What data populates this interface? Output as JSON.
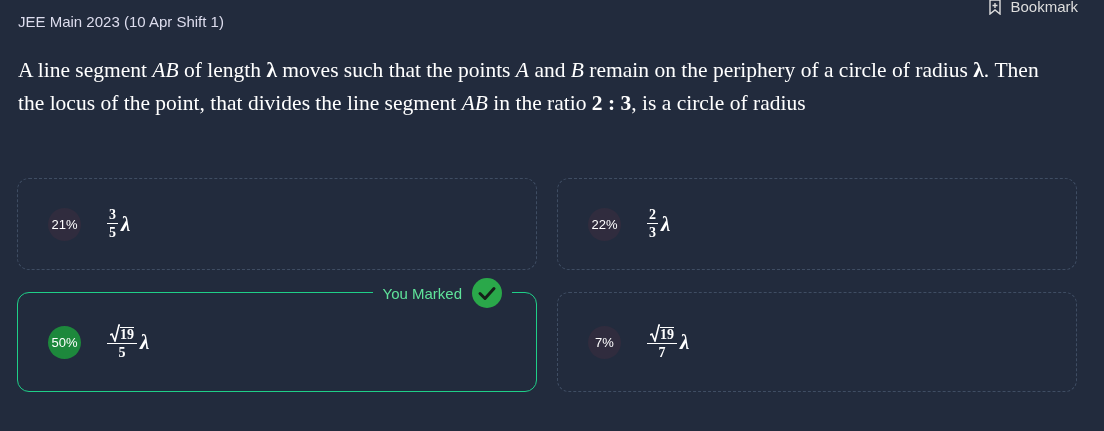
{
  "header": {
    "exam": "JEE Main 2023 (10 Apr Shift 1)",
    "bookmark": "Bookmark"
  },
  "question": "A line segment *AB* of length **λ** moves such that the points *A* and *B* remain on the periphery of a circle of radius **λ**. Then the locus of the point, that divides the line segment *AB* in the ratio **2 : 3**, is a circle of radius",
  "marked_label": "You Marked",
  "options": [
    {
      "kind": "fraction",
      "percent": "21%",
      "numerator": "3",
      "denominator": "5",
      "variable": "λ",
      "selected": false
    },
    {
      "kind": "fraction",
      "percent": "22%",
      "numerator": "2",
      "denominator": "3",
      "variable": "λ",
      "selected": false
    },
    {
      "kind": "root_fraction",
      "percent": "50%",
      "numerator": "19",
      "denominator": "5",
      "variable": "λ",
      "selected": true
    },
    {
      "kind": "root_fraction",
      "percent": "7%",
      "numerator": "19",
      "denominator": "7",
      "variable": "λ",
      "selected": false
    }
  ]
}
